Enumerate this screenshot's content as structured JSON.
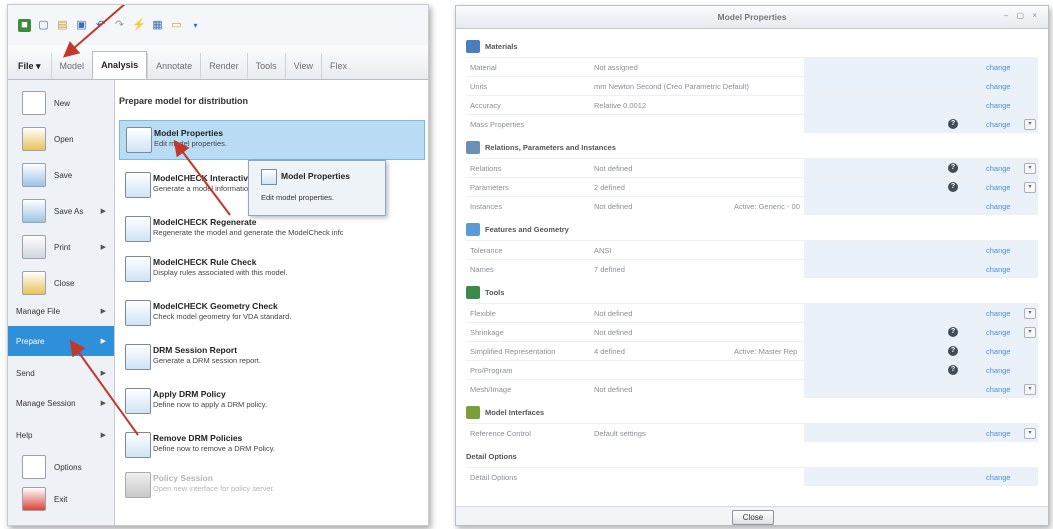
{
  "left": {
    "ribbon_tabs": [
      "File",
      "Model",
      "Analysis",
      "Annotate",
      "Render",
      "Tools",
      "View",
      "Flex"
    ],
    "file_menu": [
      {
        "label": "New",
        "arrow": false
      },
      {
        "label": "Open",
        "arrow": false
      },
      {
        "label": "Save",
        "arrow": false
      },
      {
        "label": "Save As",
        "arrow": true
      },
      {
        "label": "Print",
        "arrow": true
      },
      {
        "label": "Close",
        "arrow": false
      },
      {
        "label": "Manage File",
        "arrow": true
      },
      {
        "label": "Prepare",
        "arrow": true
      },
      {
        "label": "Send",
        "arrow": true
      },
      {
        "label": "Manage Session",
        "arrow": true
      },
      {
        "label": "Help",
        "arrow": true
      },
      {
        "label": "Options",
        "arrow": false
      },
      {
        "label": "Exit",
        "arrow": false
      }
    ],
    "submenu_title": "Prepare model for distribution",
    "submenu_items": [
      {
        "title": "Model Properties",
        "desc": "Edit model properties."
      },
      {
        "title": "ModelCHECK Interactive",
        "desc": "Generate a model information report for the assembly or drawing."
      },
      {
        "title": "ModelCHECK Regenerate",
        "desc": "Regenerate the model and generate the ModelCheck information report."
      },
      {
        "title": "ModelCHECK Rule Check",
        "desc": "Display rules associated with this model."
      },
      {
        "title": "ModelCHECK Geometry Check",
        "desc": "Check model geometry for VDA standard."
      },
      {
        "title": "DRM Session Report",
        "desc": "Generate a DRM session report."
      },
      {
        "title": "Apply DRM Policy",
        "desc": "Define now to apply a DRM policy."
      },
      {
        "title": "Remove DRM Policies",
        "desc": "Define now to remove a DRM Policy."
      },
      {
        "title": "Policy Session",
        "desc": "Open new interface for policy server."
      }
    ],
    "tooltip": {
      "title": "Model Properties",
      "desc": "Edit model properties."
    }
  },
  "right": {
    "title": "Model Properties",
    "window_controls": "– ▢ ×",
    "change_label": "change",
    "close_label": "Close",
    "sections": [
      {
        "title": "Materials",
        "color": "#4a7fbf",
        "rows": [
          {
            "name": "Material",
            "value": "Not assigned",
            "extra": "",
            "help": false,
            "expand": false
          },
          {
            "name": "Units",
            "value": "mm Newton Second (Creo Parametric Default)",
            "extra": "",
            "help": false,
            "expand": false
          },
          {
            "name": "Accuracy",
            "value": "Relative 0.0012",
            "extra": "",
            "help": false,
            "expand": false
          },
          {
            "name": "Mass Properties",
            "value": "",
            "extra": "",
            "help": true,
            "expand": true
          }
        ]
      },
      {
        "title": "Relations, Parameters and Instances",
        "color": "#6a8fb8",
        "rows": [
          {
            "name": "Relations",
            "value": "Not defined",
            "extra": "",
            "help": true,
            "expand": true
          },
          {
            "name": "Parameters",
            "value": "2 defined",
            "extra": "",
            "help": true,
            "expand": true
          },
          {
            "name": "Instances",
            "value": "Not defined",
            "extra": "Active: Generic - 00",
            "help": false,
            "expand": false
          }
        ]
      },
      {
        "title": "Features and Geometry",
        "color": "#5b9bd5",
        "rows": [
          {
            "name": "Tolerance",
            "value": "ANSI",
            "extra": "",
            "help": false,
            "expand": false
          },
          {
            "name": "Names",
            "value": "7 defined",
            "extra": "",
            "help": false,
            "expand": false
          }
        ]
      },
      {
        "title": "Tools",
        "color": "#3c8a4a",
        "rows": [
          {
            "name": "Flexible",
            "value": "Not defined",
            "extra": "",
            "help": false,
            "expand": true
          },
          {
            "name": "Shrinkage",
            "value": "Not defined",
            "extra": "",
            "help": true,
            "expand": true
          },
          {
            "name": "Simplified Representation",
            "value": "4 defined",
            "extra": "Active: Master Rep",
            "help": true,
            "expand": false
          },
          {
            "name": "Pro/Program",
            "value": "",
            "extra": "",
            "help": true,
            "expand": false
          },
          {
            "name": "Mesh/Image",
            "value": "Not defined",
            "extra": "",
            "help": false,
            "expand": true
          }
        ]
      },
      {
        "title": "Model Interfaces",
        "color": "#7a9f3a",
        "rows": [
          {
            "name": "Reference Control",
            "value": "Default settings",
            "extra": "",
            "help": false,
            "expand": true
          }
        ]
      },
      {
        "title": "Detail Options",
        "color": "",
        "rows": [
          {
            "name": "Detail Options",
            "value": "",
            "extra": "",
            "help": false,
            "expand": false
          }
        ]
      }
    ]
  }
}
